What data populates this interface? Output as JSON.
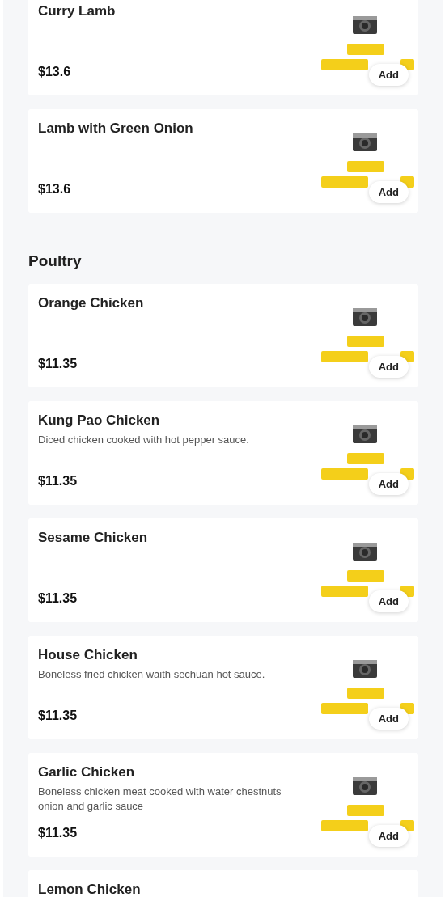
{
  "sections": [
    {
      "items": [
        {
          "name": "Curry Lamb",
          "price": "$13.6",
          "button": "Add"
        },
        {
          "name": "Lamb with Green Onion",
          "price": "$13.6",
          "button": "Add"
        }
      ]
    },
    {
      "title": "Poultry",
      "items": [
        {
          "name": "Orange Chicken",
          "price": "$11.35",
          "button": "Add"
        },
        {
          "name": "Kung Pao Chicken",
          "description": "Diced chicken cooked with hot pepper sauce.",
          "price": "$11.35",
          "button": "Add"
        },
        {
          "name": "Sesame Chicken",
          "price": "$11.35",
          "button": "Add"
        },
        {
          "name": "House Chicken",
          "description": "Boneless fried chicken waith sechuan hot sauce.",
          "price": "$11.35",
          "button": "Add"
        },
        {
          "name": "Garlic Chicken",
          "description": "Boneless chicken meat cooked with water chestnuts onion and garlic sauce",
          "price": "$11.35",
          "button": "Add"
        },
        {
          "name": "Lemon Chicken"
        }
      ]
    }
  ]
}
